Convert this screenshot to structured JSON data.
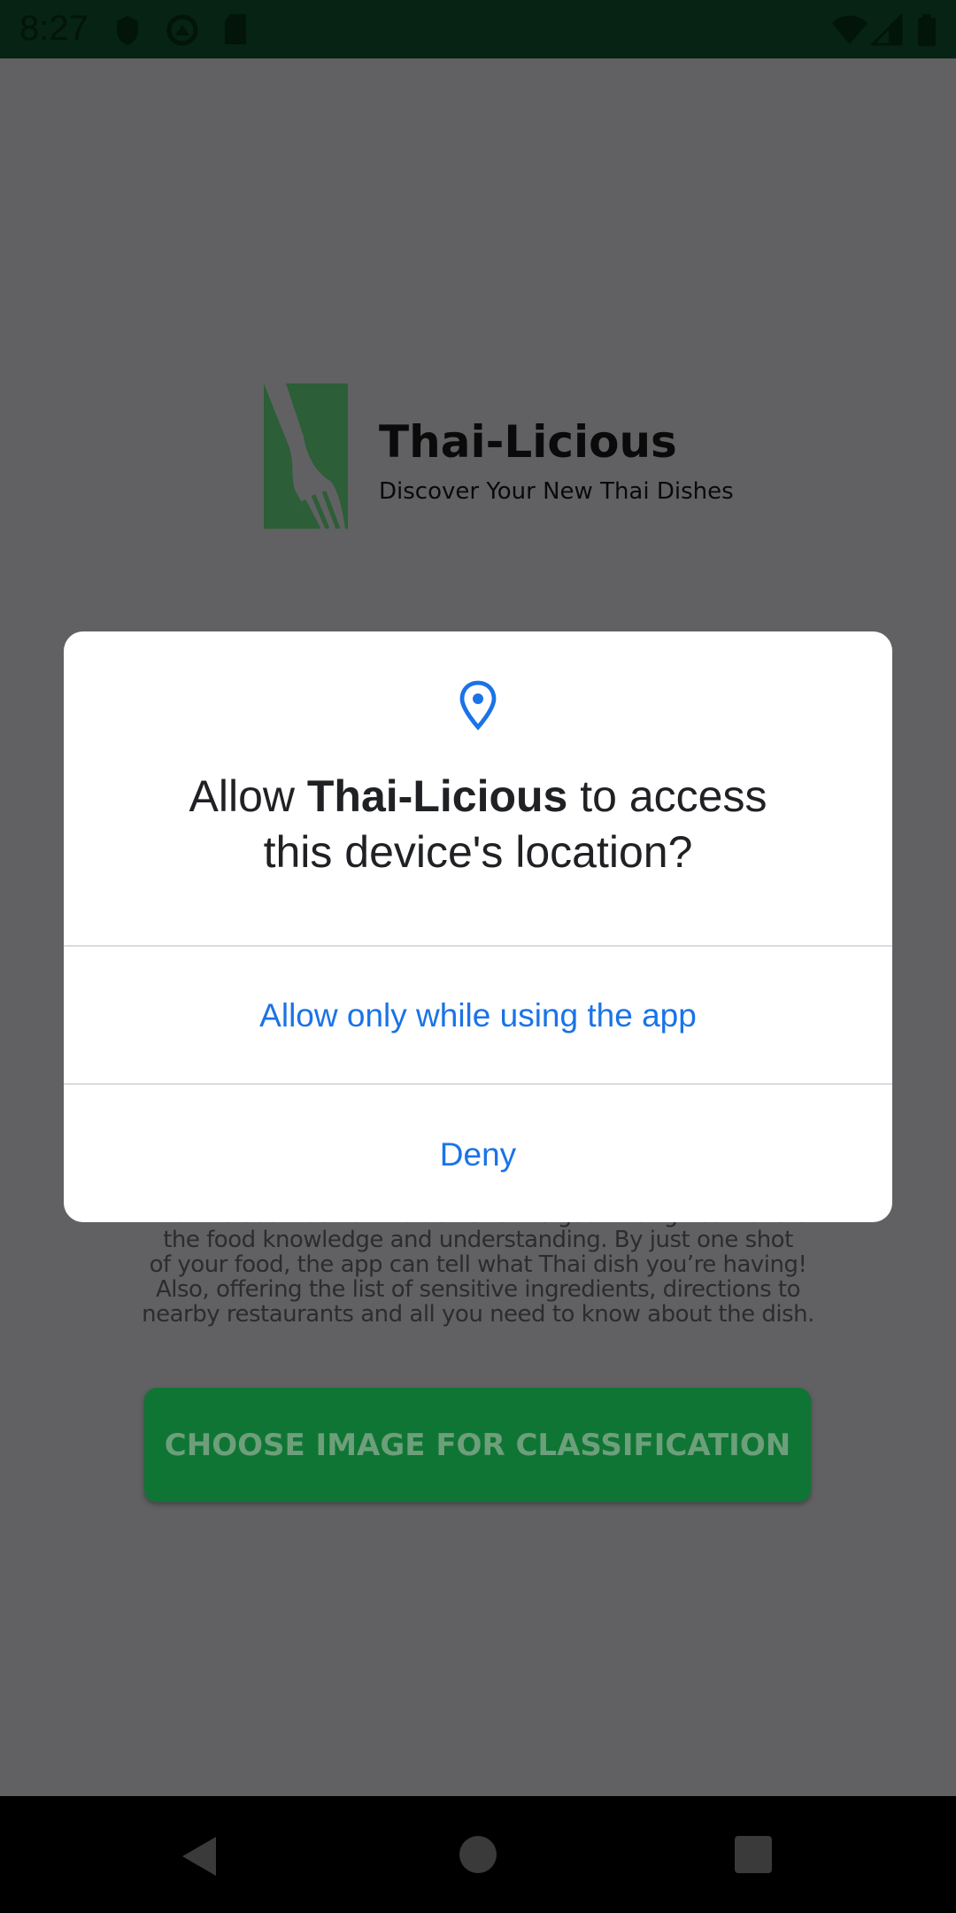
{
  "status_bar": {
    "time": "8:27",
    "icons": [
      "shield-icon",
      "sync-icon",
      "sd-card-icon",
      "wifi-icon",
      "signal-icon",
      "battery-icon"
    ]
  },
  "app": {
    "title": "Thai-Licious",
    "subtitle": "Discover Your New Thai Dishes",
    "description": [
      "Thai-Licious was built to achieve the goal that gives visitors",
      "the food knowledge and understanding. By just one shot",
      "of your food, the app can tell what Thai dish you’re having!",
      "Also, offering the list of sensitive ingredients, directions to",
      "nearby restaurants and all you need to know about the dish."
    ],
    "choose_button": "CHOOSE IMAGE FOR CLASSIFICATION",
    "accent": "#1e9e4a"
  },
  "dialog": {
    "title_prefix": "Allow ",
    "app_name": "Thai-Licious",
    "title_suffix": " to access",
    "title_line2": "this device's location?",
    "allow_button": "Allow only while using the app",
    "deny_button": "Deny",
    "accent": "#1a73e8"
  }
}
